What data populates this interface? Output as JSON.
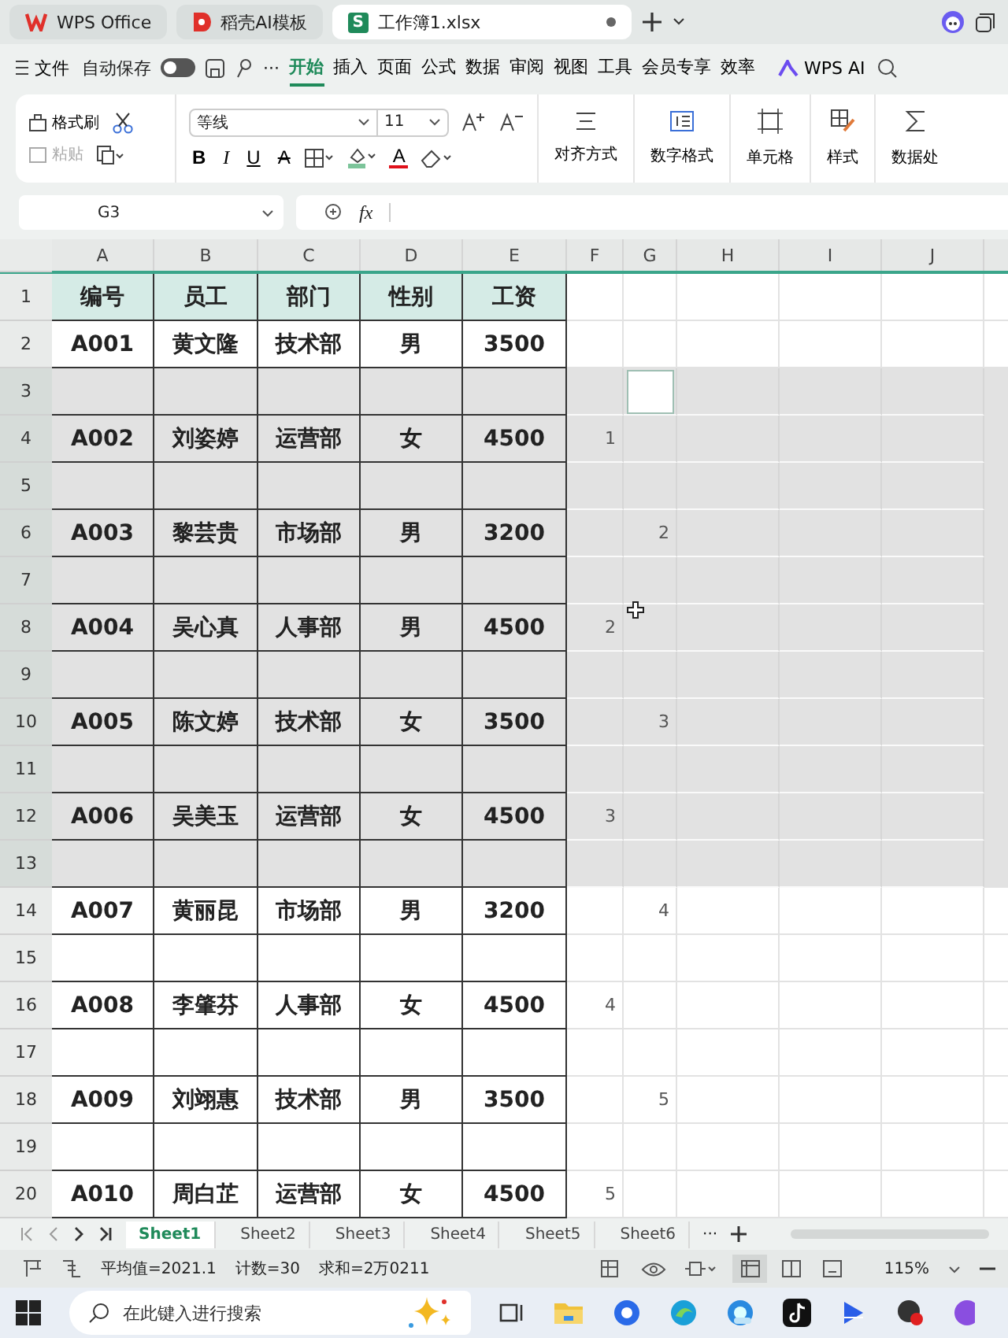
{
  "tabs": [
    {
      "kind": "wps",
      "label": "WPS Office",
      "selected": false
    },
    {
      "kind": "template",
      "label": "稻壳AI模板",
      "selected": false
    },
    {
      "kind": "sheet",
      "logo": "S",
      "label": "工作簿1.xlsx",
      "selected": true
    }
  ],
  "menu": {
    "file": "文件",
    "autosave": {
      "label": "自动保存",
      "on": false
    },
    "more": "···",
    "items": [
      {
        "label": "开始",
        "selected": true
      },
      {
        "label": "插入",
        "selected": false
      },
      {
        "label": "页面",
        "selected": false
      },
      {
        "label": "公式",
        "selected": false
      },
      {
        "label": "数据",
        "selected": false
      },
      {
        "label": "审阅",
        "selected": false
      },
      {
        "label": "视图",
        "selected": false
      },
      {
        "label": "工具",
        "selected": false
      },
      {
        "label": "会员专享",
        "selected": false
      },
      {
        "label": "效率",
        "selected": false
      }
    ],
    "ai": "WPS AI"
  },
  "ribbon": {
    "format_painter": "格式刷",
    "paste": {
      "label": "粘贴",
      "disabled": true
    },
    "font": "等线",
    "size": "11",
    "bold": "B",
    "italic": "I",
    "underline": "U",
    "strike": "A",
    "font_color": "A",
    "groups": [
      "对齐方式",
      "数字格式",
      "单元格",
      "样式",
      "数据处"
    ]
  },
  "formula_bar": {
    "name_box": "G3",
    "fx": "fx"
  },
  "columns": [
    "A",
    "B",
    "C",
    "D",
    "E",
    "F",
    "G",
    "H",
    "I",
    "J"
  ],
  "rows": [
    {
      "number": "1",
      "kind": "header",
      "selected": false,
      "cells": [
        "编号",
        "员工",
        "部门",
        "性别",
        "工资"
      ]
    },
    {
      "number": "2",
      "kind": "data",
      "selected": false,
      "cells": [
        "A001",
        "黄文隆",
        "技术部",
        "男",
        "3500"
      ]
    },
    {
      "number": "3",
      "kind": "blank",
      "selected": true,
      "active": true
    },
    {
      "number": "4",
      "kind": "data",
      "selected": true,
      "cells": [
        "A002",
        "刘姿婷",
        "运营部",
        "女",
        "4500"
      ],
      "f": "1"
    },
    {
      "number": "5",
      "kind": "blank",
      "selected": true
    },
    {
      "number": "6",
      "kind": "data",
      "selected": true,
      "cells": [
        "A003",
        "黎芸贵",
        "市场部",
        "男",
        "3200"
      ],
      "g": "2"
    },
    {
      "number": "7",
      "kind": "blank",
      "selected": true
    },
    {
      "number": "8",
      "kind": "data",
      "selected": true,
      "cells": [
        "A004",
        "吴心真",
        "人事部",
        "男",
        "4500"
      ],
      "f": "2"
    },
    {
      "number": "9",
      "kind": "blank",
      "selected": true
    },
    {
      "number": "10",
      "kind": "data",
      "selected": true,
      "cells": [
        "A005",
        "陈文婷",
        "技术部",
        "女",
        "3500"
      ],
      "g": "3"
    },
    {
      "number": "11",
      "kind": "blank",
      "selected": true
    },
    {
      "number": "12",
      "kind": "data",
      "selected": true,
      "cells": [
        "A006",
        "吴美玉",
        "运营部",
        "女",
        "4500"
      ],
      "f": "3"
    },
    {
      "number": "13",
      "kind": "blank",
      "selected": true
    },
    {
      "number": "14",
      "kind": "data",
      "selected": false,
      "cells": [
        "A007",
        "黄丽昆",
        "市场部",
        "男",
        "3200"
      ],
      "g": "4"
    },
    {
      "number": "15",
      "kind": "blank",
      "selected": false
    },
    {
      "number": "16",
      "kind": "data",
      "selected": false,
      "cells": [
        "A008",
        "李肇芬",
        "人事部",
        "女",
        "4500"
      ],
      "f": "4"
    },
    {
      "number": "17",
      "kind": "blank",
      "selected": false
    },
    {
      "number": "18",
      "kind": "data",
      "selected": false,
      "cells": [
        "A009",
        "刘翊惠",
        "技术部",
        "男",
        "3500"
      ],
      "g": "5"
    },
    {
      "number": "19",
      "kind": "blank",
      "selected": false
    },
    {
      "number": "20",
      "kind": "data",
      "selected": false,
      "cells": [
        "A010",
        "周白芷",
        "运营部",
        "女",
        "4500"
      ],
      "f": "5"
    }
  ],
  "sheets": [
    {
      "label": "Sheet1",
      "selected": true
    },
    {
      "label": "Sheet2",
      "selected": false
    },
    {
      "label": "Sheet3",
      "selected": false
    },
    {
      "label": "Sheet4",
      "selected": false
    },
    {
      "label": "Sheet5",
      "selected": false
    },
    {
      "label": "Sheet6",
      "selected": false
    }
  ],
  "sheet_more": "···",
  "status": {
    "items": [
      "平均值=2021.1",
      "计数=30",
      "求和=2万0211"
    ],
    "zoom": "115%"
  },
  "taskbar": {
    "search_placeholder": "在此键入进行搜索"
  }
}
